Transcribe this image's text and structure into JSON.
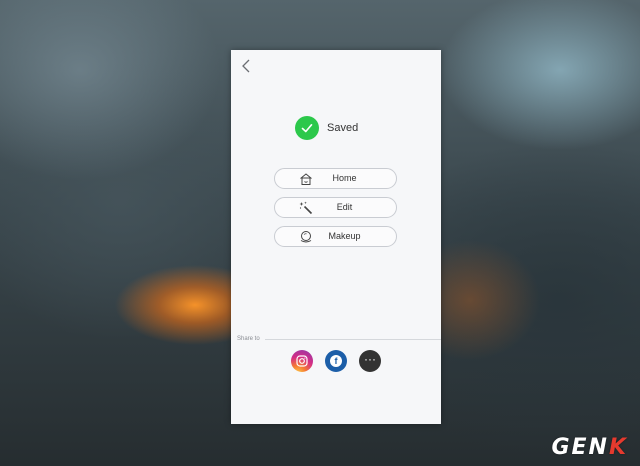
{
  "status": {
    "saved_text": "Saved"
  },
  "actions": [
    {
      "label": "Home",
      "icon": "home-icon"
    },
    {
      "label": "Edit",
      "icon": "magic-wand-icon"
    },
    {
      "label": "Makeup",
      "icon": "compact-mirror-icon"
    }
  ],
  "share": {
    "label": "Share to",
    "targets": [
      {
        "name": "instagram-icon"
      },
      {
        "name": "facebook-icon",
        "glyph": "f"
      },
      {
        "name": "more-icon",
        "glyph": "···"
      }
    ]
  },
  "watermark": {
    "text_main": "GEN",
    "text_accent": "K"
  },
  "colors": {
    "check": "#2cc84b",
    "facebook": "#1c5ea8",
    "more": "#333333",
    "watermark_accent": "#e63a2e"
  }
}
